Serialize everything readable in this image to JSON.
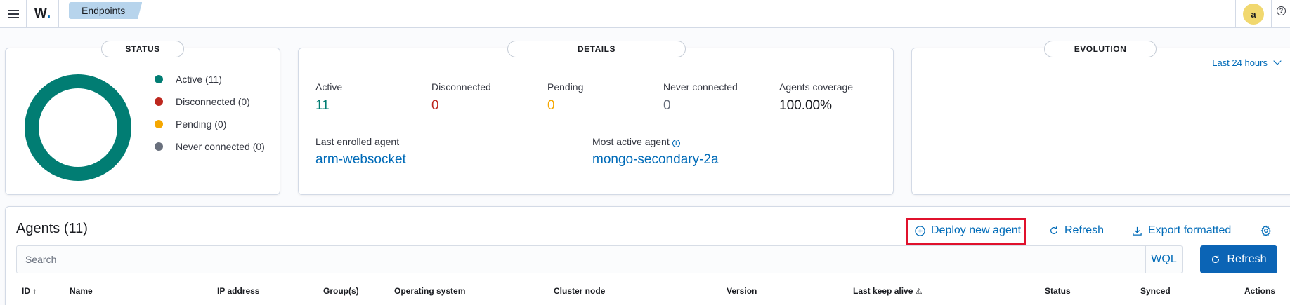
{
  "header": {
    "logo_text": "W",
    "breadcrumb": "Endpoints",
    "avatar_initial": "a",
    "help_glyph": "?"
  },
  "status_panel": {
    "title": "STATUS",
    "legend": [
      {
        "label": "Active (11)",
        "color": "#017d73"
      },
      {
        "label": "Disconnected (0)",
        "color": "#bd271e"
      },
      {
        "label": "Pending (0)",
        "color": "#f5a700"
      },
      {
        "label": "Never connected (0)",
        "color": "#69707d"
      }
    ]
  },
  "details_panel": {
    "title": "DETAILS",
    "stats": [
      {
        "label": "Active",
        "value": "11",
        "color": "#017d73"
      },
      {
        "label": "Disconnected",
        "value": "0",
        "color": "#bd271e"
      },
      {
        "label": "Pending",
        "value": "0",
        "color": "#f5a700"
      },
      {
        "label": "Never connected",
        "value": "0",
        "color": "#69707d"
      },
      {
        "label": "Agents coverage",
        "value": "100.00%",
        "color": "#1a1c21"
      }
    ],
    "last_enrolled_label": "Last enrolled agent",
    "last_enrolled_value": "arm-websocket",
    "most_active_label": "Most active agent",
    "most_active_value": "mongo-secondary-2a"
  },
  "evolution_panel": {
    "title": "EVOLUTION",
    "range_selector": "Last 24 hours"
  },
  "agents_section": {
    "title": "Agents (11)",
    "deploy_label": "Deploy new agent",
    "refresh_label": "Refresh",
    "export_label": "Export formatted",
    "search_placeholder": "Search",
    "wql_label": "WQL",
    "refresh_primary_label": "Refresh",
    "columns": [
      "ID",
      "Name",
      "IP address",
      "Group(s)",
      "Operating system",
      "Cluster node",
      "Version",
      "Last keep alive",
      "Status",
      "Synced",
      "Actions"
    ]
  },
  "colors": {
    "accent": "#006bb8",
    "primary_button": "#0b64b5",
    "highlight_box": "#e0112c"
  }
}
